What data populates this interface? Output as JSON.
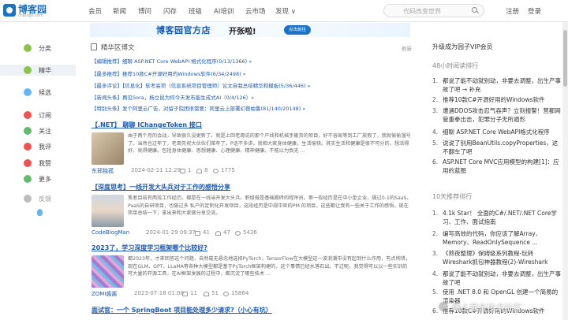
{
  "brand": {
    "name": "博客园",
    "domain": "cnblogs.com",
    "color": "#1b73c6"
  },
  "nav": {
    "items": [
      "会员",
      "新闻",
      "博问",
      "闪存",
      "班级",
      "AI培训",
      "云市场",
      "发现 ∨"
    ],
    "search_placeholder": "代码改变世界",
    "login": "注册",
    "logout": "登录"
  },
  "banner": {
    "title": "博客园官方店",
    "subtitle": "开张啦!",
    "badge": "点击前往"
  },
  "sidebar": {
    "items": [
      {
        "label": "分类",
        "icon": "category-icon",
        "color": "#8bc34a"
      },
      {
        "label": "精华",
        "icon": "essence-icon",
        "color": "#8bc34a"
      },
      {
        "label": "候选",
        "icon": "candidate-icon",
        "color": "#64b5f6"
      },
      {
        "label": "订阅",
        "icon": "subscribe-icon",
        "color": "#ef5350"
      },
      {
        "label": "关注",
        "icon": "follow-icon",
        "color": "#66bb6a"
      },
      {
        "label": "我评",
        "icon": "my-comment-icon",
        "color": "#ef5350"
      },
      {
        "label": "我赞",
        "icon": "my-like-icon",
        "color": "#ef5350"
      },
      {
        "label": "更多",
        "icon": "more-icon",
        "color": "#66bb6a"
      },
      {
        "label": "反馈",
        "icon": "feedback-icon",
        "color": "#bdbdbd"
      }
    ]
  },
  "main": {
    "section_title": "精华区博文",
    "refresh": "刷新",
    "pinned": [
      "【编辑推荐】细聊 ASP.NET Core WebAPI 格式化程序(0/13/1366) »",
      "【最多推荐】推荐10款C#开源好用的Windows软件(6/34/2498) »",
      "【最多评论】【信息化】软考高项（信息系统项目管理师）论文自我总结精华和模板(5/36/446) »",
      "【新闻头条】再见Sora，杨立昆为何今天发布能生成式AI（0/4/126）»",
      "【特别头条】发个阿里云广告，对留子院团很需要：阿里云上部署幻兽帕鲁(81/140/20148) »"
    ],
    "posts": [
      {
        "title": "【.NET】 聊聊 IChangeToken 接口",
        "excerpt": "由于两个月的会战，导致很久没更新了。就是上回老周说的那个产线和机械手搬货的项目，好不容易等到工厂放假了，我就偷偷溜号了。当然也过年了，老周先祝大伙伙们菜年了。P话不多讲，就相大家身体健康，生活愉快。其实生活和健康是很不可分的，想活得好，就得健康。包括身体健康、思想健康、心理健康、精神健康。不能以为我无 ...",
        "author": "东邪独孤",
        "date": "2024-02-11 12:29",
        "comments": "1",
        "likes": "8",
        "views": "1775",
        "thumb_color": "#c8b59a"
      },
      {
        "title": "【深度思考】一线开发大头兵对于工作的感悟分享",
        "excerpt": "笔者目前有两段工作经历。都是在一线当开发大头兵。职级做是基础搬砖的程序员。第一段经历是在中小型企业，做过0-1的SaaS、PaaS的自研项目，也做过多 私户的定制化开发项目，这段经历是中规中矩的PM 的项目，这些都让我有一些关于工作的感悟。现在简单总结一下，拿出来和大家做分享交流。",
        "author": "CodeBlogMan",
        "date": "2024-01-29 09:37",
        "comments": "41",
        "likes": "47",
        "views": "5436",
        "thumb_color": "#a7b4c2"
      },
      {
        "title": "2023了，学习深度学习框架哪个比较好?",
        "excerpt": "都2023年，才来回答这个问题，自然毫无悬念地选择PyTorch，TensorFlow在大模型这一波浪潮中没有起到什么作用，有点惋惜，现在GLM、GPT、LLaMA等各种大模型都是基于PyTorch框架构建的，这个事情已经水落石出。不过呢，我觉得可以以一些实训的可大量的开源工具，在AI框架发展的过程中，都沉淀了哪些技术 ...",
        "author": "ZOMI酱酱",
        "date": "2023-07-18 01:00",
        "comments": "11",
        "likes": "51",
        "views": "15864",
        "thumb_color": "#9b6fc0"
      },
      {
        "title": "面试官：一个 SpringBoot 项目能处理多少请求?（小心有坑）",
        "excerpt": "",
        "author": "",
        "date": "",
        "comments": "",
        "likes": "",
        "views": "",
        "thumb_color": "#ffffff"
      }
    ]
  },
  "right": {
    "vip": "升级成为园子VIP会员",
    "hot_head": "48小时阅读排行",
    "hot": [
      "都说了能不动就别动，非要去调整，出生产事故了吧 → 补充",
      "推荐10款C#开源好用的Windows软件",
      "遭遇DDOS攻击忍气吞声？立刻报警！营都网管重拳出击，犯罪分子无所遁形",
      "细聊 ASP.NET Core WebAPI格式化程序",
      "说说了别用BeanUtils.copyProperties，这不翻车了吧",
      "ASP.NET Core MVC应用模型的构建[1]：应用的蓝图"
    ],
    "rec_head": "10天推荐排行",
    "rec": [
      "4.1k Star！ 全面的C#/.NET/.NET Core学习、工作、面试指南",
      "编写高效的代码，你应该了解Array、Memory、ReadOnlySequence ...",
      "《熬夜整理》保姆级系列教程-玩转Wireshark抓包神器教程(2)-Wireshark",
      "都说了能不动就别动，非要去调整，出生产事故了吧",
      "使用 .NET 8.0 和 OpenGL 创建一个简易的渲染器",
      "推荐10款C#开源好用的Windows软件"
    ]
  },
  "watermark": "稀土掘金技术社区"
}
